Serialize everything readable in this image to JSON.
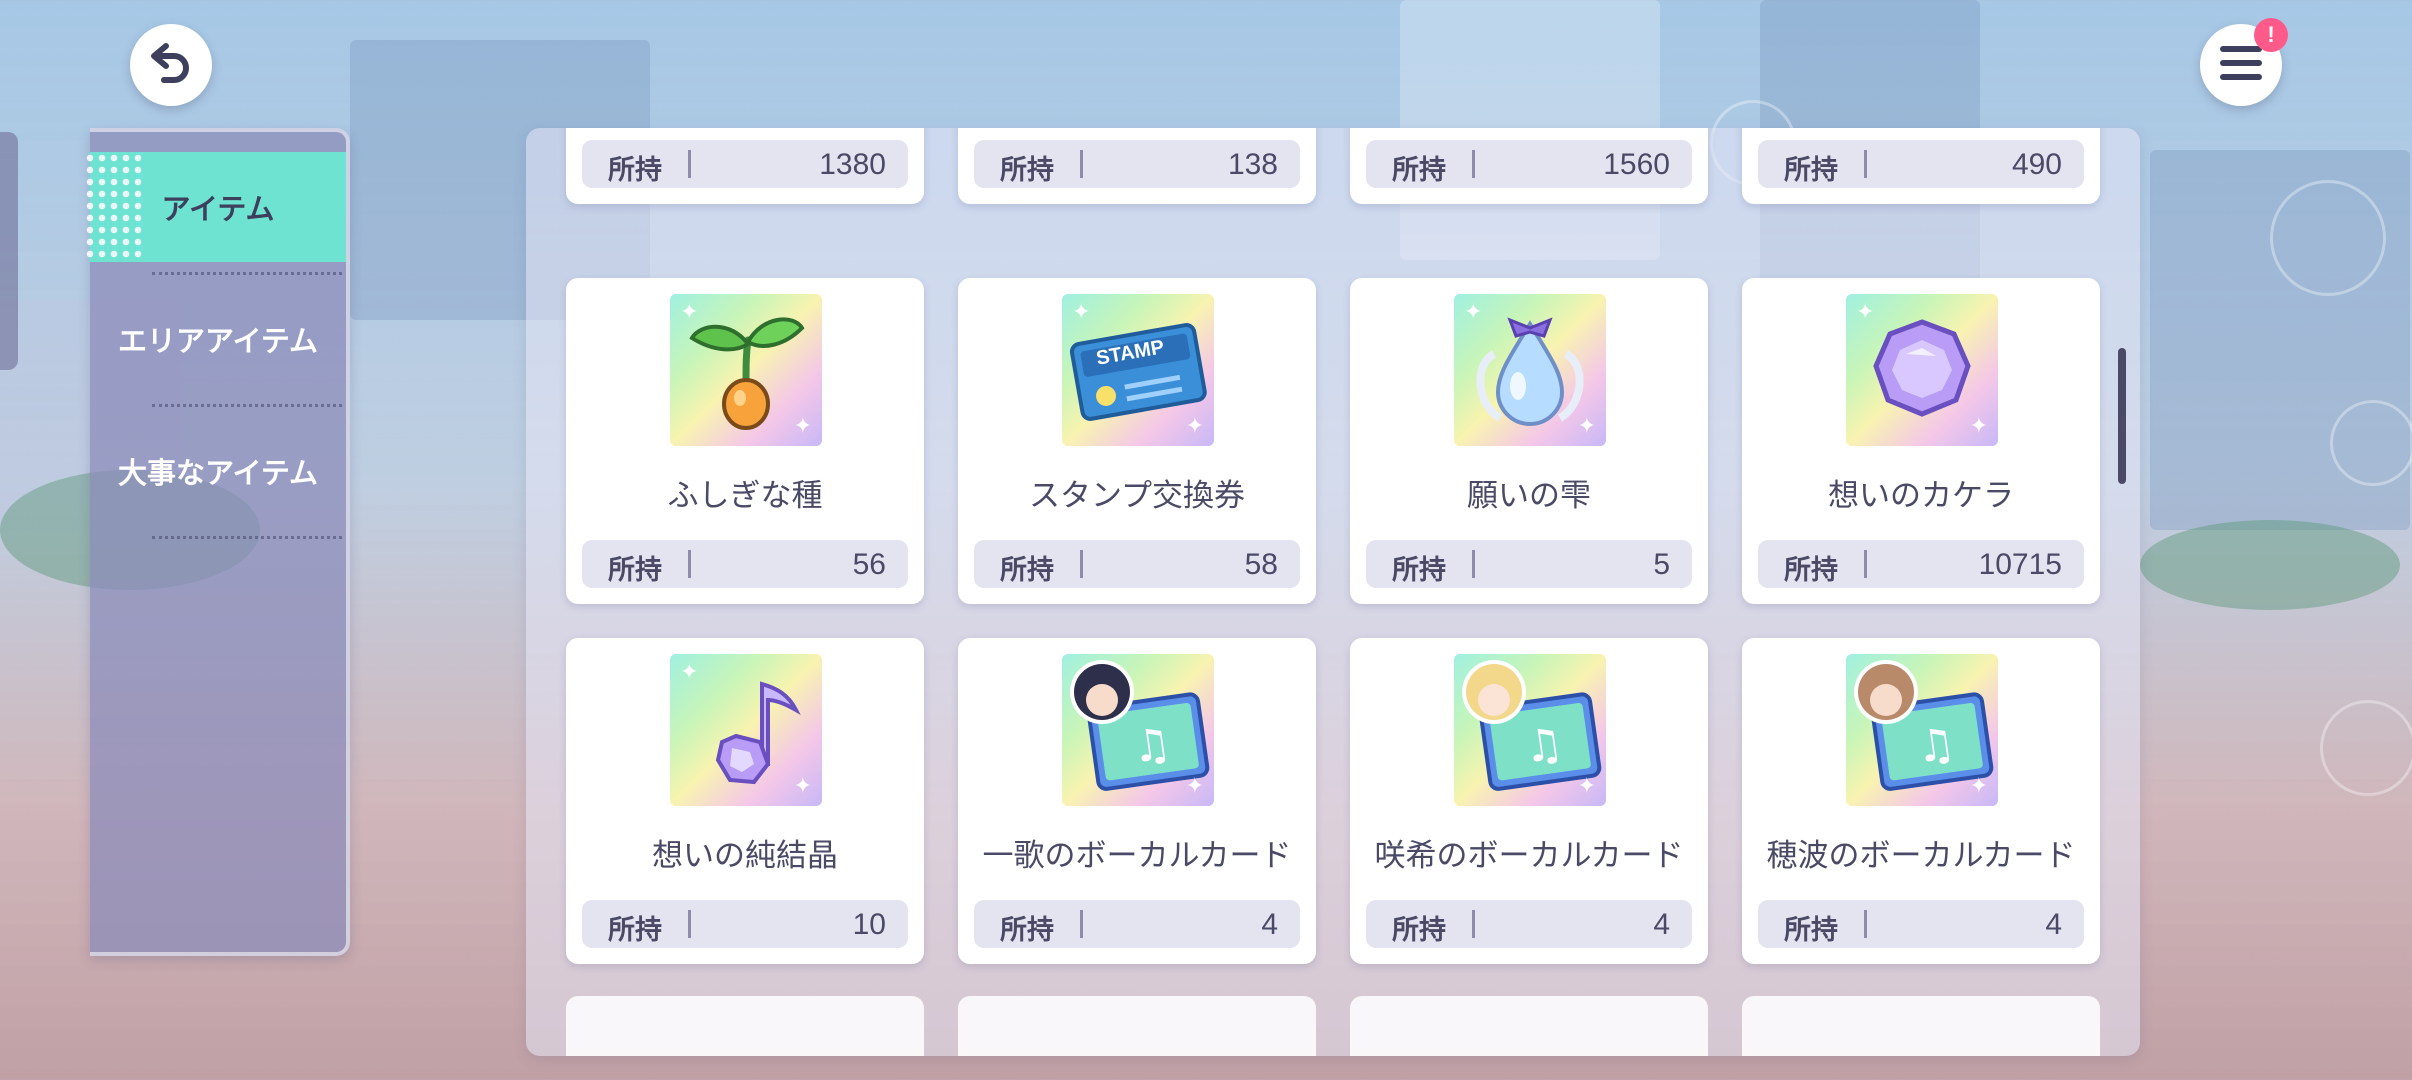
{
  "nav": {
    "back_icon": "back-arrow-icon",
    "menu_icon": "hamburger-menu-icon",
    "menu_badge": "!"
  },
  "sidebar": {
    "items": [
      {
        "label": "アイテム",
        "active": true
      },
      {
        "label": "エリアアイテム",
        "active": false
      },
      {
        "label": "大事なアイテム",
        "active": false
      }
    ]
  },
  "owned_label": "所持",
  "top_row": [
    {
      "count": "1380"
    },
    {
      "count": "138"
    },
    {
      "count": "1560"
    },
    {
      "count": "490"
    }
  ],
  "items": [
    {
      "name": "ふしぎな種",
      "count": "56",
      "icon": "sprout-seed-icon"
    },
    {
      "name": "スタンプ交換券",
      "count": "58",
      "icon": "stamp-ticket-icon",
      "icon_text": "STAMP"
    },
    {
      "name": "願いの雫",
      "count": "5",
      "icon": "wish-drop-icon"
    },
    {
      "name": "想いのカケラ",
      "count": "10715",
      "icon": "feeling-fragment-gem-icon"
    },
    {
      "name": "想いの純結晶",
      "count": "10",
      "icon": "pure-crystal-note-icon"
    },
    {
      "name": "一歌のボーカルカード",
      "count": "4",
      "icon": "ichika-vocal-card-icon"
    },
    {
      "name": "咲希のボーカルカード",
      "count": "4",
      "icon": "saki-vocal-card-icon"
    },
    {
      "name": "穂波のボーカルカード",
      "count": "4",
      "icon": "honami-vocal-card-icon"
    }
  ],
  "colors": {
    "accent": "#6fe3d2",
    "text": "#4a4a66",
    "badge": "#ff5a8a"
  }
}
